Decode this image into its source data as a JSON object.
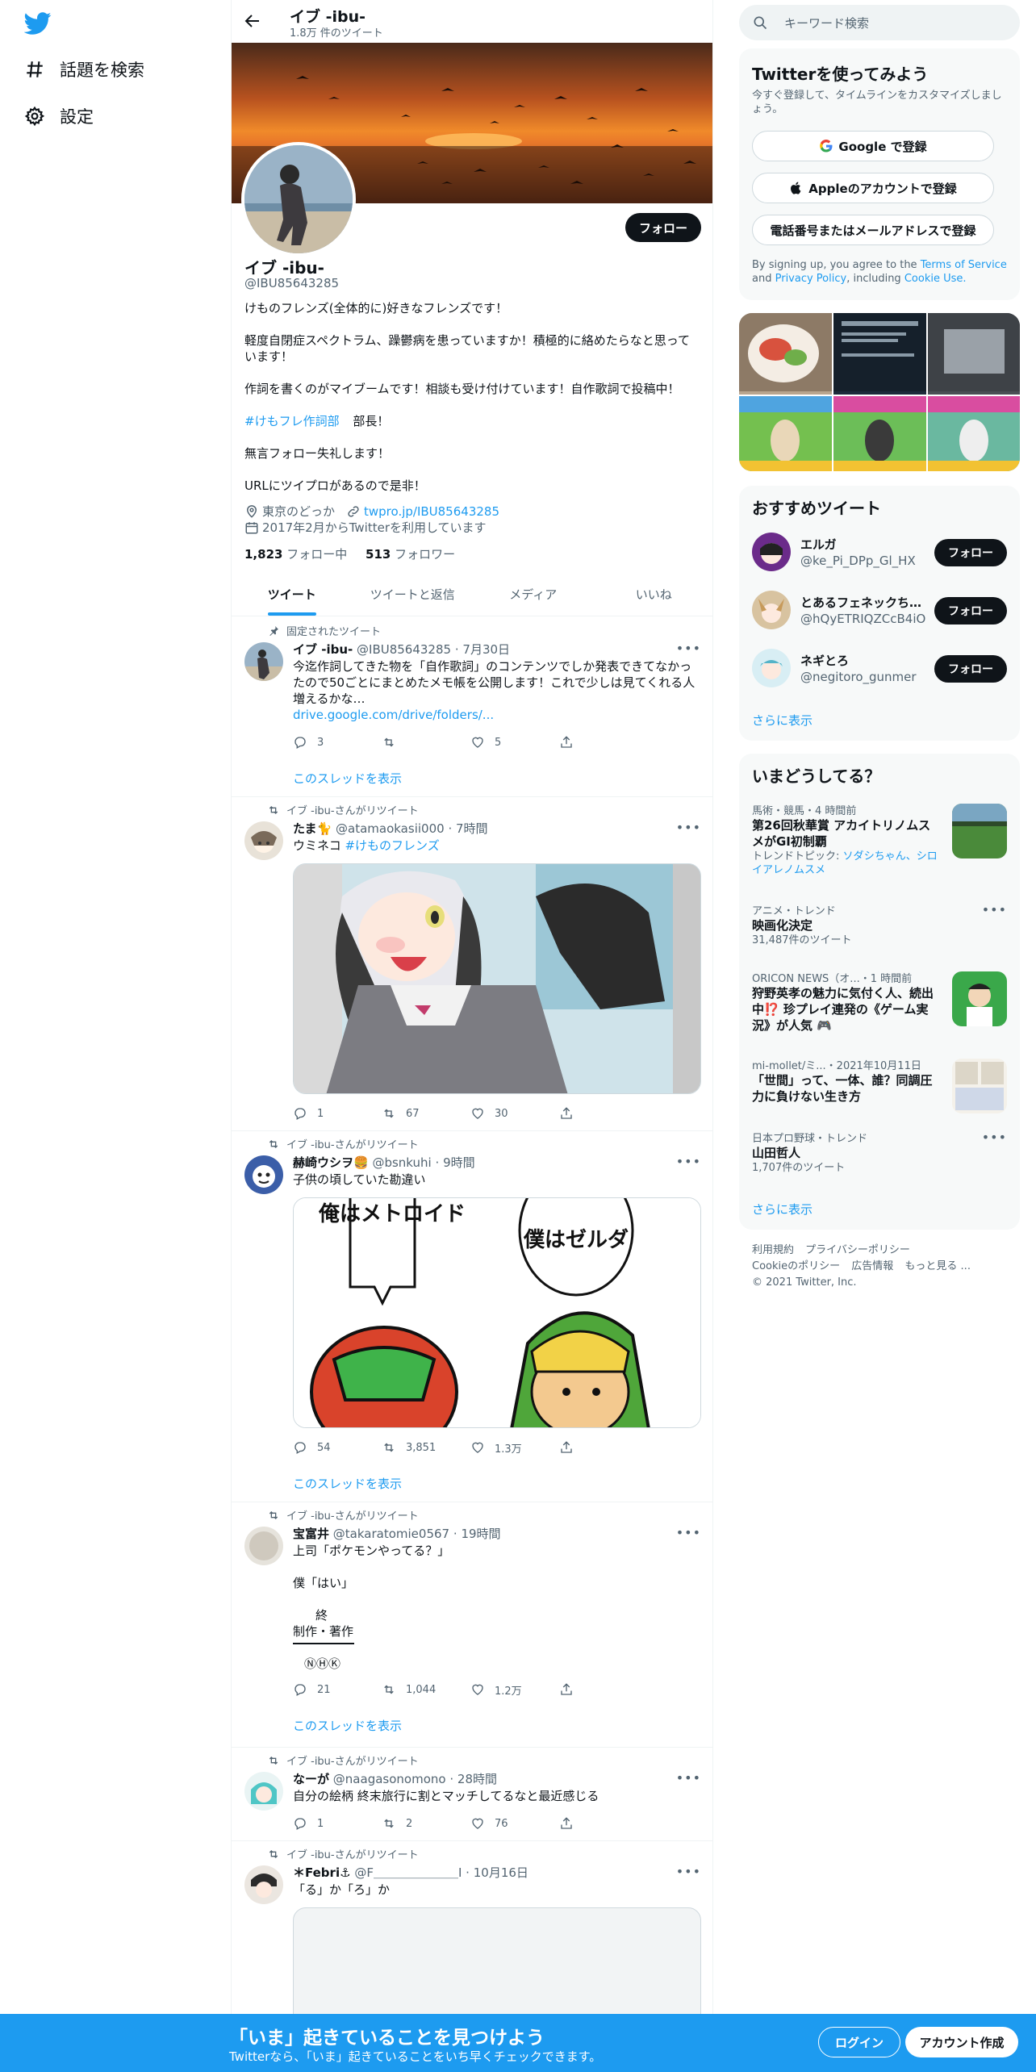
{
  "nav": {
    "explore": "話題を検索",
    "settings": "設定"
  },
  "header": {
    "title": "イブ -ibu-",
    "subtitle": "1.8万 件のツイート"
  },
  "profile": {
    "follow": "フォロー",
    "name": "イブ -ibu-",
    "handle": "@IBU85643285",
    "bio": [
      "けものフレンズ(全体的に)好きなフレンズです！",
      "軽度自閉症スペクトラム、躁鬱病を患っていますか！積極的に絡めたらなと思っています！",
      "作詞を書くのがマイブームです！相談も受け付けています！自作歌詞で投稿中！",
      "部長！",
      "無言フォロー失礼します！",
      "URLにツイプロがあるので是非！"
    ],
    "hashtag": "#けもフレ作詞部",
    "location": "東京のどっか",
    "url": "twpro.jp/IBU85643285",
    "joined": "2017年2月からTwitterを利用しています",
    "following_count": "1,823",
    "following_label": "フォロー中",
    "followers_count": "513",
    "followers_label": "フォロワー"
  },
  "tabs": [
    "ツイート",
    "ツイートと返信",
    "メディア",
    "いいね"
  ],
  "tweets": [
    {
      "context": "固定されたツイート",
      "name": "イブ -ibu-",
      "handle": "@IBU85643285",
      "time": "7月30日",
      "text": "今迄作詞してきた物を「自作歌詞」のコンテンツでしか発表できてなかったので50ごとにまとめたメモ帳を公開します！これで少しは見てくれる人増えるかな…",
      "link": "drive.google.com/drive/folders/...",
      "replies": "3",
      "retweets": "",
      "likes": "5",
      "thread": "このスレッドを表示"
    },
    {
      "context": "イブ -ibu-さんがリツイート",
      "name": "たま🐈",
      "handle": "@atamaokasii000",
      "time": "7時間",
      "text": "ウミネコ",
      "hashtag": "#けものフレンズ",
      "replies": "1",
      "retweets": "67",
      "likes": "30"
    },
    {
      "context": "イブ -ibu-さんがリツイート",
      "name": "赫崎ウシヲ🍔",
      "handle": "@bsnkuhi",
      "time": "9時間",
      "text": "子供の頃していた勘違い",
      "bubble_left": "俺はメトロイド",
      "bubble_right": "僕はゼルダ",
      "replies": "54",
      "retweets": "3,851",
      "likes": "1.3万",
      "thread": "このスレッドを表示"
    },
    {
      "context": "イブ -ibu-さんがリツイート",
      "name": "宝富井",
      "handle": "@takaratomie0567",
      "time": "19時間",
      "line1": "上司「ポケモンやってる？」",
      "line2": "僕「はい」",
      "line3": "終",
      "line4": "制作・著作",
      "line5": "ⓃⒽⓀ",
      "replies": "21",
      "retweets": "1,044",
      "likes": "1.2万",
      "thread": "このスレッドを表示"
    },
    {
      "context": "イブ -ibu-さんがリツイート",
      "name": "なーが",
      "handle": "@naagasonomono",
      "time": "28時間",
      "text": "自分の絵柄 終末旅行に割とマッチしてるなと最近感じる",
      "replies": "1",
      "retweets": "2",
      "likes": "76"
    },
    {
      "context": "イブ -ibu-さんがリツイート",
      "name": "＊Febri⚓",
      "handle": "@F＿＿＿＿＿＿＿I",
      "time": "10月16日",
      "text": "「る」か「ろ」か"
    }
  ],
  "right": {
    "search_placeholder": "キーワード検索",
    "signup_card": {
      "title": "Twitterを使ってみよう",
      "sub": "今すぐ登録して、タイムラインをカスタマイズしましょう。",
      "google": "Google で登録",
      "apple": "Appleのアカウントで登録",
      "phone": "電話番号またはメールアドレスで登録",
      "terms_prefix": "By signing up, you agree to the",
      "terms": "Terms of Service",
      "and": "and",
      "privacy": "Privacy Policy",
      "including": ", including",
      "cookie": "Cookie Use."
    },
    "who": {
      "title": "おすすめツイート",
      "users": [
        {
          "name": "エルガ",
          "handle": "@ke_Pi_DPp_Gl_HX",
          "btn": "フォロー"
        },
        {
          "name": "とあるフェネックちゃん",
          "handle": "@hQyETRIQZCcB4iO",
          "btn": "フォロー"
        },
        {
          "name": "ネギとろ",
          "handle": "@negitoro_gunmer",
          "btn": "フォロー"
        }
      ],
      "more": "さらに表示"
    },
    "trends": {
      "title": "いまどうしてる？",
      "items": [
        {
          "cat": "馬術・競馬・4 時間前",
          "title": "第26回秋華賞 アカイトリノムスメがGI初制覇",
          "sub_prefix": "トレンドトピック:",
          "sub_link": "ソダシちゃん、シロイアレノムスメ"
        },
        {
          "cat": "アニメ・トレンド",
          "title": "映画化決定",
          "sub": "31,487件のツイート"
        },
        {
          "cat": "ORICON NEWS（オ...・1 時間前",
          "title": "狩野英孝の魅力に気付く人、続出中⁉️ 珍プレイ連発の《ゲーム実況》が人気 🎮"
        },
        {
          "cat": "mi-mollet/ミ...・2021年10月11日",
          "title": "「世間」って、一体、誰？同調圧力に負けない生き方"
        },
        {
          "cat": "日本プロ野球・トレンド",
          "title": "山田哲人",
          "sub": "1,707件のツイート"
        }
      ],
      "more": "さらに表示"
    },
    "footer": {
      "l1": "利用規約",
      "l2": "プライバシーポリシー",
      "l3": "Cookieのポリシー",
      "l4": "広告情報",
      "l5": "もっと見る ...",
      "copy": "© 2021 Twitter, Inc."
    }
  },
  "bottombar": {
    "title": "「いま」起きていることを見つけよう",
    "sub": "Twitterなら、「いま」起きていることをいち早くチェックできます。",
    "login": "ログイン",
    "signup": "アカウント作成"
  },
  "colors": {
    "accent": "#1d9bf0",
    "text": "#0f1419",
    "muted": "#536471"
  }
}
